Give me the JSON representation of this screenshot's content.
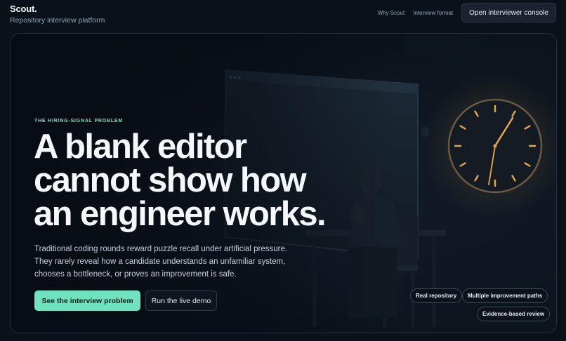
{
  "brand": {
    "name": "Scout.",
    "subtitle": "Repository interview platform"
  },
  "nav": {
    "links": [
      "Why Scout",
      "Interview format"
    ],
    "console_button": "Open interviewer console"
  },
  "hero": {
    "eyebrow": "THE HIRING-SIGNAL PROBLEM",
    "headline": "A blank editor cannot show how an engineer works.",
    "body": "Traditional coding rounds reward puzzle recall under artificial pressure. They rarely reveal how a candidate understands an unfamiliar system, chooses a bottleneck, or proves an improvement is safe.",
    "primary_cta": "See the interview problem",
    "secondary_cta": "Run the live demo",
    "tags": [
      "Real repository",
      "Multiple improvement paths",
      "Evidence-based review"
    ]
  },
  "colors": {
    "accent": "#6fe3bf",
    "background": "#0b1119",
    "clock_glow": "#e8a64a"
  },
  "icons": [
    "wall-clock-icon",
    "monitor-icon",
    "person-at-desk-icon"
  ]
}
